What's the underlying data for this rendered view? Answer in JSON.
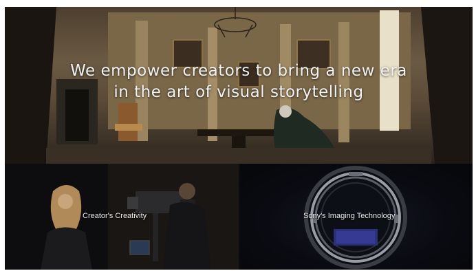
{
  "hero": {
    "headline_line1": "We empower creators to bring a new era",
    "headline_line2": "in the art of visual storytelling"
  },
  "panels": {
    "left_caption": "Creator's Creativity",
    "right_caption": "Sony's Imaging Technology"
  },
  "colors": {
    "text": "#f2f2f2",
    "background": "#07090d"
  }
}
